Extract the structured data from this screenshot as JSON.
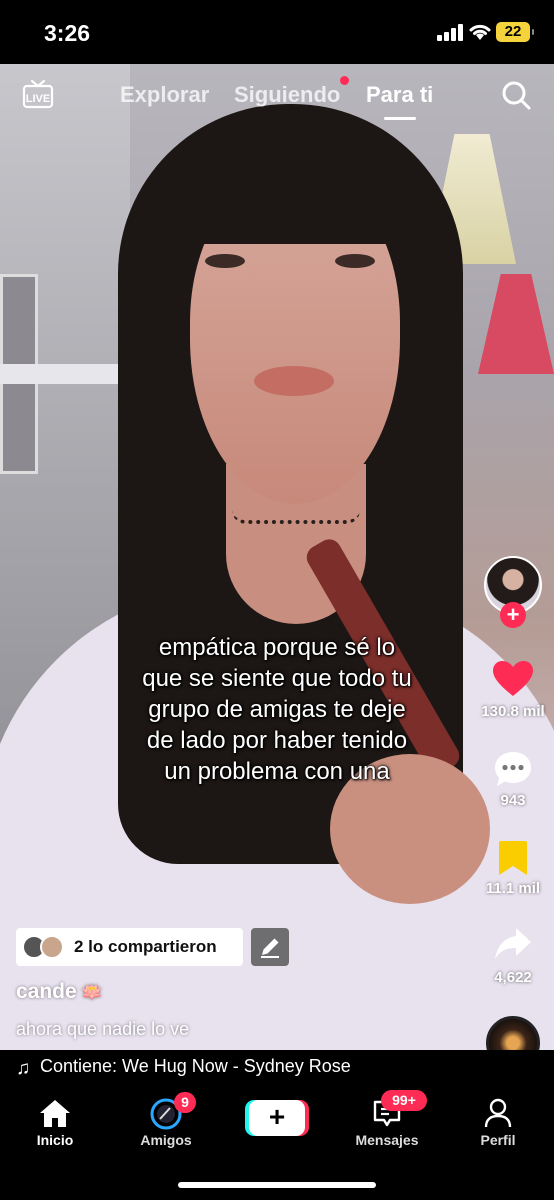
{
  "status_bar": {
    "time": "3:26",
    "battery": "22"
  },
  "top_nav": {
    "live_label": "LIVE",
    "tabs": [
      {
        "label": "Explorar",
        "active": false
      },
      {
        "label": "Siguiendo",
        "active": false,
        "has_dot": true
      },
      {
        "label": "Para ti",
        "active": true
      }
    ]
  },
  "video": {
    "caption_lines": [
      "empática porque sé lo",
      "que se siente que todo tu",
      "grupo de amigas te deje",
      "de lado por haber tenido",
      "un problema con una"
    ]
  },
  "right_rail": {
    "follow_label": "+",
    "likes": "130.8 mil",
    "comments": "943",
    "saves": "11.1 mil",
    "shares": "4,622"
  },
  "post_info": {
    "shared_by": "2 lo compartieron",
    "username": "cande",
    "username_emoji": "🪷",
    "description": "ahora que nadie lo ve",
    "music": "Contiene: We Hug Now - Sydney Rose"
  },
  "tab_bar": {
    "items": [
      {
        "label": "Inicio",
        "icon": "home-icon"
      },
      {
        "label": "Amigos",
        "icon": "friends-icon",
        "badge": "9"
      },
      {
        "label": "+",
        "icon": "create-icon"
      },
      {
        "label": "Mensajes",
        "icon": "inbox-icon",
        "badge": "99+"
      },
      {
        "label": "Perfil",
        "icon": "profile-icon"
      }
    ]
  },
  "colors": {
    "accent": "#fe2c55",
    "cyan": "#25f4ee",
    "save": "#facd00"
  }
}
